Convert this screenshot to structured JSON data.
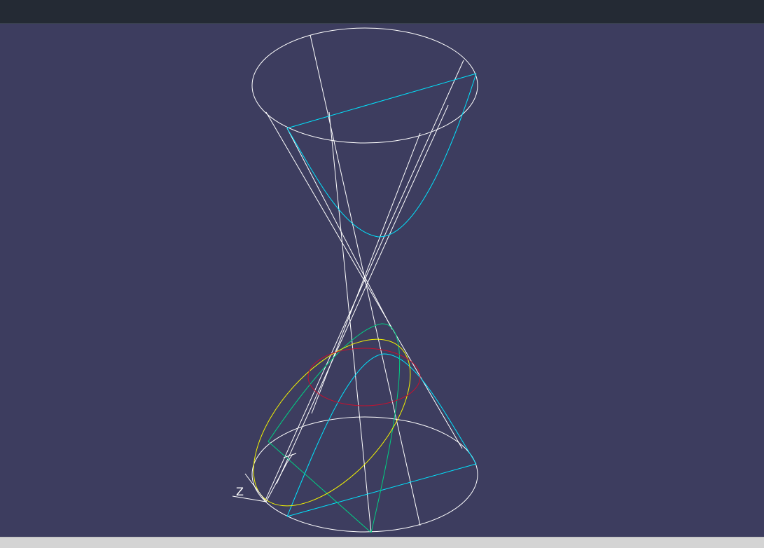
{
  "window": {
    "top_bar": "",
    "status_bar": ""
  },
  "viewport": {
    "background": "#3d3d5f",
    "icons": [
      "ucs-axis-icon"
    ],
    "colors": {
      "cone_edges": "#ffffff",
      "parabola": "#00e5ff",
      "hyperbola_cut": "#00d084",
      "ellipse_section": "#f5f500",
      "circle_section": "#c8102e"
    },
    "ucs_label": "Z"
  }
}
